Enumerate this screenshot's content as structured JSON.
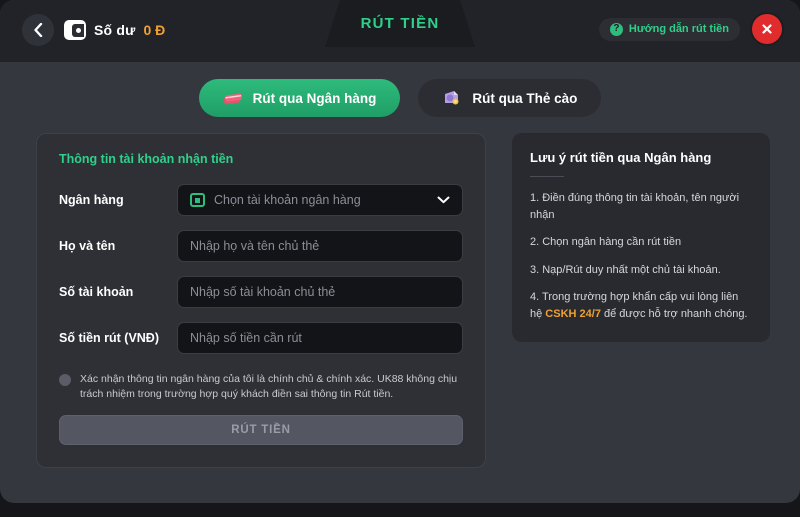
{
  "header": {
    "back_icon": "chevron-left-icon",
    "wallet_icon": "wallet-icon",
    "balance_label": "Số dư",
    "balance_value": "0 Đ",
    "title": "RÚT TIỀN",
    "help_icon": "question-circle-icon",
    "help_label": "Hướng dẫn rút tiền",
    "close_icon": "close-icon"
  },
  "tabs": [
    {
      "label": "Rút qua Ngân hàng",
      "icon": "bank-cards-icon",
      "active": true
    },
    {
      "label": "Rút qua Thẻ cào",
      "icon": "scratch-card-icon",
      "active": false
    }
  ],
  "form": {
    "section_title": "Thông tin tài khoản nhận tiền",
    "fields": [
      {
        "label": "Ngân hàng",
        "placeholder": "Chọn tài khoản ngân hàng",
        "value": "",
        "type": "select",
        "icon": "bank-icon",
        "chevron": "chevron-down-icon"
      },
      {
        "label": "Họ và tên",
        "placeholder": "Nhập họ và tên chủ thẻ",
        "value": "",
        "type": "text"
      },
      {
        "label": "Số tài khoản",
        "placeholder": "Nhập số tài khoản chủ thẻ",
        "value": "",
        "type": "text"
      },
      {
        "label": "Số tiền rút (VNĐ)",
        "placeholder": "Nhập số tiền cần rút",
        "value": "",
        "type": "text"
      }
    ],
    "consent_text": "Xác nhận thông tin ngân hàng của tôi là chính chủ & chính xác. UK88 không chịu trách nhiệm trong trường hợp quý khách điền sai thông tin Rút tiền.",
    "consent_checked": false,
    "submit_label": "RÚT TIỀN"
  },
  "notes": {
    "title": "Lưu ý rút tiền qua Ngân hàng",
    "items": [
      "1. Điền đúng thông tin tài khoản, tên người nhận",
      "2. Chọn ngân hàng cần rút tiền",
      "3. Nạp/Rút duy nhất một chủ tài khoản."
    ],
    "item4_prefix": "4. Trong trường hợp khẩn cấp vui lòng liên hệ ",
    "item4_highlight": "CSKH 24/7",
    "item4_suffix": " để được hỗ trợ nhanh chóng."
  },
  "colors": {
    "accent_green": "#2fd18a",
    "accent_orange": "#f0a030",
    "close_red": "#e02c2c",
    "panel_bg": "#2e3036",
    "modal_bg": "#34373e"
  }
}
